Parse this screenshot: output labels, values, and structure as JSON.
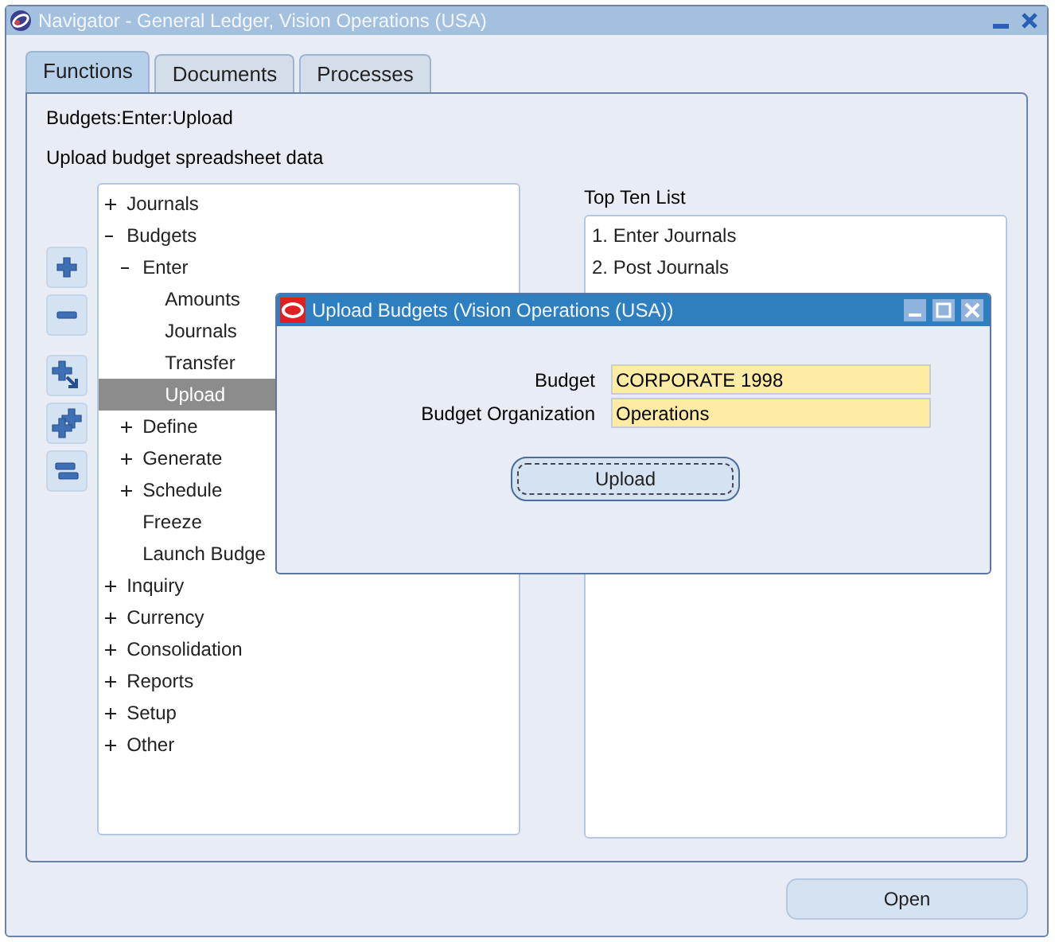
{
  "window": {
    "title": "Navigator - General Ledger, Vision Operations (USA)"
  },
  "tabs": [
    {
      "label": "Functions",
      "selected": true
    },
    {
      "label": "Documents",
      "selected": false
    },
    {
      "label": "Processes",
      "selected": false
    }
  ],
  "path": "Budgets:Enter:Upload",
  "description": "Upload budget spreadsheet data",
  "tree": [
    {
      "label": "Journals",
      "expanded": false,
      "selected": false
    },
    {
      "label": "Budgets",
      "expanded": true,
      "selected": false,
      "children": [
        {
          "label": "Enter",
          "expanded": true,
          "selected": false,
          "children": [
            {
              "label": "Amounts",
              "selected": false
            },
            {
              "label": "Journals",
              "selected": false
            },
            {
              "label": "Transfer",
              "selected": false
            },
            {
              "label": "Upload",
              "selected": true
            }
          ]
        },
        {
          "label": "Define",
          "expanded": false,
          "selected": false
        },
        {
          "label": "Generate",
          "expanded": false,
          "selected": false
        },
        {
          "label": "Schedule",
          "expanded": false,
          "selected": false
        },
        {
          "label": "Freeze",
          "selected": false
        },
        {
          "label": "Launch Budge",
          "selected": false
        }
      ]
    },
    {
      "label": "Inquiry",
      "expanded": false,
      "selected": false
    },
    {
      "label": "Currency",
      "expanded": false,
      "selected": false
    },
    {
      "label": "Consolidation",
      "expanded": false,
      "selected": false
    },
    {
      "label": "Reports",
      "expanded": false,
      "selected": false
    },
    {
      "label": "Setup",
      "expanded": false,
      "selected": false
    },
    {
      "label": "Other",
      "expanded": false,
      "selected": false
    }
  ],
  "top_ten": {
    "title": "Top Ten List",
    "items": [
      "1. Enter Journals",
      "2. Post Journals"
    ]
  },
  "open_button": "Open",
  "dialog": {
    "title": "Upload Budgets (Vision Operations (USA))",
    "fields": [
      {
        "label": "Budget",
        "value": "CORPORATE 1998"
      },
      {
        "label": "Budget Organization",
        "value": "Operations"
      }
    ],
    "button": "Upload"
  }
}
